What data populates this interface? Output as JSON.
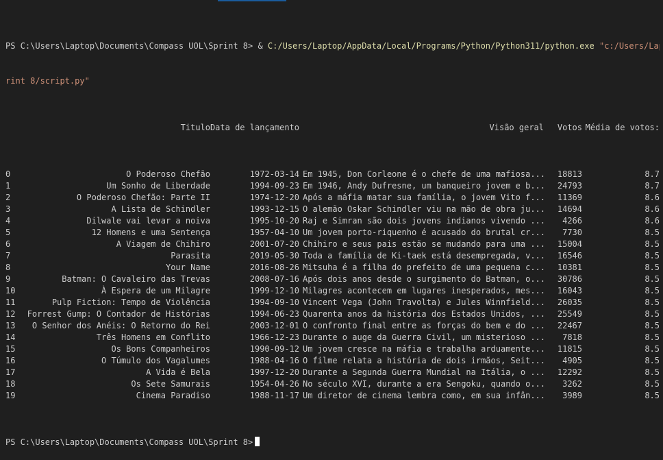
{
  "terminal": {
    "cmd_prompt": "PS C:\\Users\\Laptop\\Documents\\Compass UOL\\Sprint 8> ",
    "cmd_amp": "& ",
    "cmd_exe": "C:/Users/Laptop/AppData/Local/Programs/Python/Python311/python.exe",
    "cmd_space": " ",
    "cmd_script_part1": "\"c:/Users/Laptop",
    "cmd_script_part2": "rint 8/script.py\"",
    "final_prompt": "PS C:\\Users\\Laptop\\Documents\\Compass UOL\\Sprint 8>"
  },
  "table": {
    "headers": {
      "title": "Titulo",
      "date": "Data de lançamento",
      "overview": "Visão geral",
      "votes": "Votos",
      "avg": "Média de votos:"
    },
    "rows": [
      {
        "idx": "0",
        "title": "O Poderoso Chefão",
        "date": "1972-03-14",
        "overview": "Em 1945, Don Corleone é o chefe de uma mafiosa...",
        "votes": "18813",
        "avg": "8.7"
      },
      {
        "idx": "1",
        "title": "Um Sonho de Liberdade",
        "date": "1994-09-23",
        "overview": "Em 1946, Andy Dufresne, um banqueiro jovem e b...",
        "votes": "24793",
        "avg": "8.7"
      },
      {
        "idx": "2",
        "title": "O Poderoso Chefão: Parte II",
        "date": "1974-12-20",
        "overview": "Após a máfia matar sua família, o jovem Vito f...",
        "votes": "11369",
        "avg": "8.6"
      },
      {
        "idx": "3",
        "title": "A Lista de Schindler",
        "date": "1993-12-15",
        "overview": "O alemão Oskar Schindler viu na mão de obra ju...",
        "votes": "14694",
        "avg": "8.6"
      },
      {
        "idx": "4",
        "title": "Dilwale vai levar a noiva",
        "date": "1995-10-20",
        "overview": "Raj e Simran são dois jovens indianos vivendo ...",
        "votes": "4266",
        "avg": "8.6"
      },
      {
        "idx": "5",
        "title": "12 Homens e uma Sentença",
        "date": "1957-04-10",
        "overview": "Um jovem porto-riquenho é acusado do brutal cr...",
        "votes": "7730",
        "avg": "8.5"
      },
      {
        "idx": "6",
        "title": "A Viagem de Chihiro",
        "date": "2001-07-20",
        "overview": "Chihiro e seus pais estão se mudando para uma ...",
        "votes": "15004",
        "avg": "8.5"
      },
      {
        "idx": "7",
        "title": "Parasita",
        "date": "2019-05-30",
        "overview": "Toda a família de Ki-taek está desempregada, v...",
        "votes": "16546",
        "avg": "8.5"
      },
      {
        "idx": "8",
        "title": "Your Name",
        "date": "2016-08-26",
        "overview": "Mitsuha é a filha do prefeito de uma pequena c...",
        "votes": "10381",
        "avg": "8.5"
      },
      {
        "idx": "9",
        "title": "Batman: O Cavaleiro das Trevas",
        "date": "2008-07-16",
        "overview": "Após dois anos desde o surgimento do Batman, o...",
        "votes": "30786",
        "avg": "8.5"
      },
      {
        "idx": "10",
        "title": "À Espera de um Milagre",
        "date": "1999-12-10",
        "overview": "Milagres acontecem em lugares inesperados, mes...",
        "votes": "16043",
        "avg": "8.5"
      },
      {
        "idx": "11",
        "title": "Pulp Fiction: Tempo de Violência",
        "date": "1994-09-10",
        "overview": "Vincent Vega (John Travolta) e Jules Winnfield...",
        "votes": "26035",
        "avg": "8.5"
      },
      {
        "idx": "12",
        "title": "Forrest Gump: O Contador de Histórias",
        "date": "1994-06-23",
        "overview": "Quarenta anos da história dos Estados Unidos, ...",
        "votes": "25549",
        "avg": "8.5"
      },
      {
        "idx": "13",
        "title": "O Senhor dos Anéis: O Retorno do Rei",
        "date": "2003-12-01",
        "overview": "O confronto final entre as forças do bem e do ...",
        "votes": "22467",
        "avg": "8.5"
      },
      {
        "idx": "14",
        "title": "Três Homens em Conflito",
        "date": "1966-12-23",
        "overview": "Durante o auge da Guerra Civil, um misterioso ...",
        "votes": "7818",
        "avg": "8.5"
      },
      {
        "idx": "15",
        "title": "Os Bons Companheiros",
        "date": "1990-09-12",
        "overview": "Um jovem cresce na máfia e trabalha arduamente...",
        "votes": "11815",
        "avg": "8.5"
      },
      {
        "idx": "16",
        "title": "O Túmulo dos Vagalumes",
        "date": "1988-04-16",
        "overview": "O filme relata a história de dois irmãos, Seit...",
        "votes": "4905",
        "avg": "8.5"
      },
      {
        "idx": "17",
        "title": "A Vida é Bela",
        "date": "1997-12-20",
        "overview": "Durante a Segunda Guerra Mundial na Itália, o ...",
        "votes": "12292",
        "avg": "8.5"
      },
      {
        "idx": "18",
        "title": "Os Sete Samurais",
        "date": "1954-04-26",
        "overview": "No século XVI, durante a era Sengoku, quando o...",
        "votes": "3262",
        "avg": "8.5"
      },
      {
        "idx": "19",
        "title": "Cinema Paradiso",
        "date": "1988-11-17",
        "overview": "Um diretor de cinema lembra como, em sua infân...",
        "votes": "3989",
        "avg": "8.5"
      }
    ]
  },
  "colors": {
    "background": "#1f1f1f",
    "text": "#cccccc",
    "executable": "#dcdcaa",
    "string": "#ce9178",
    "cursor": "#ffffff"
  }
}
